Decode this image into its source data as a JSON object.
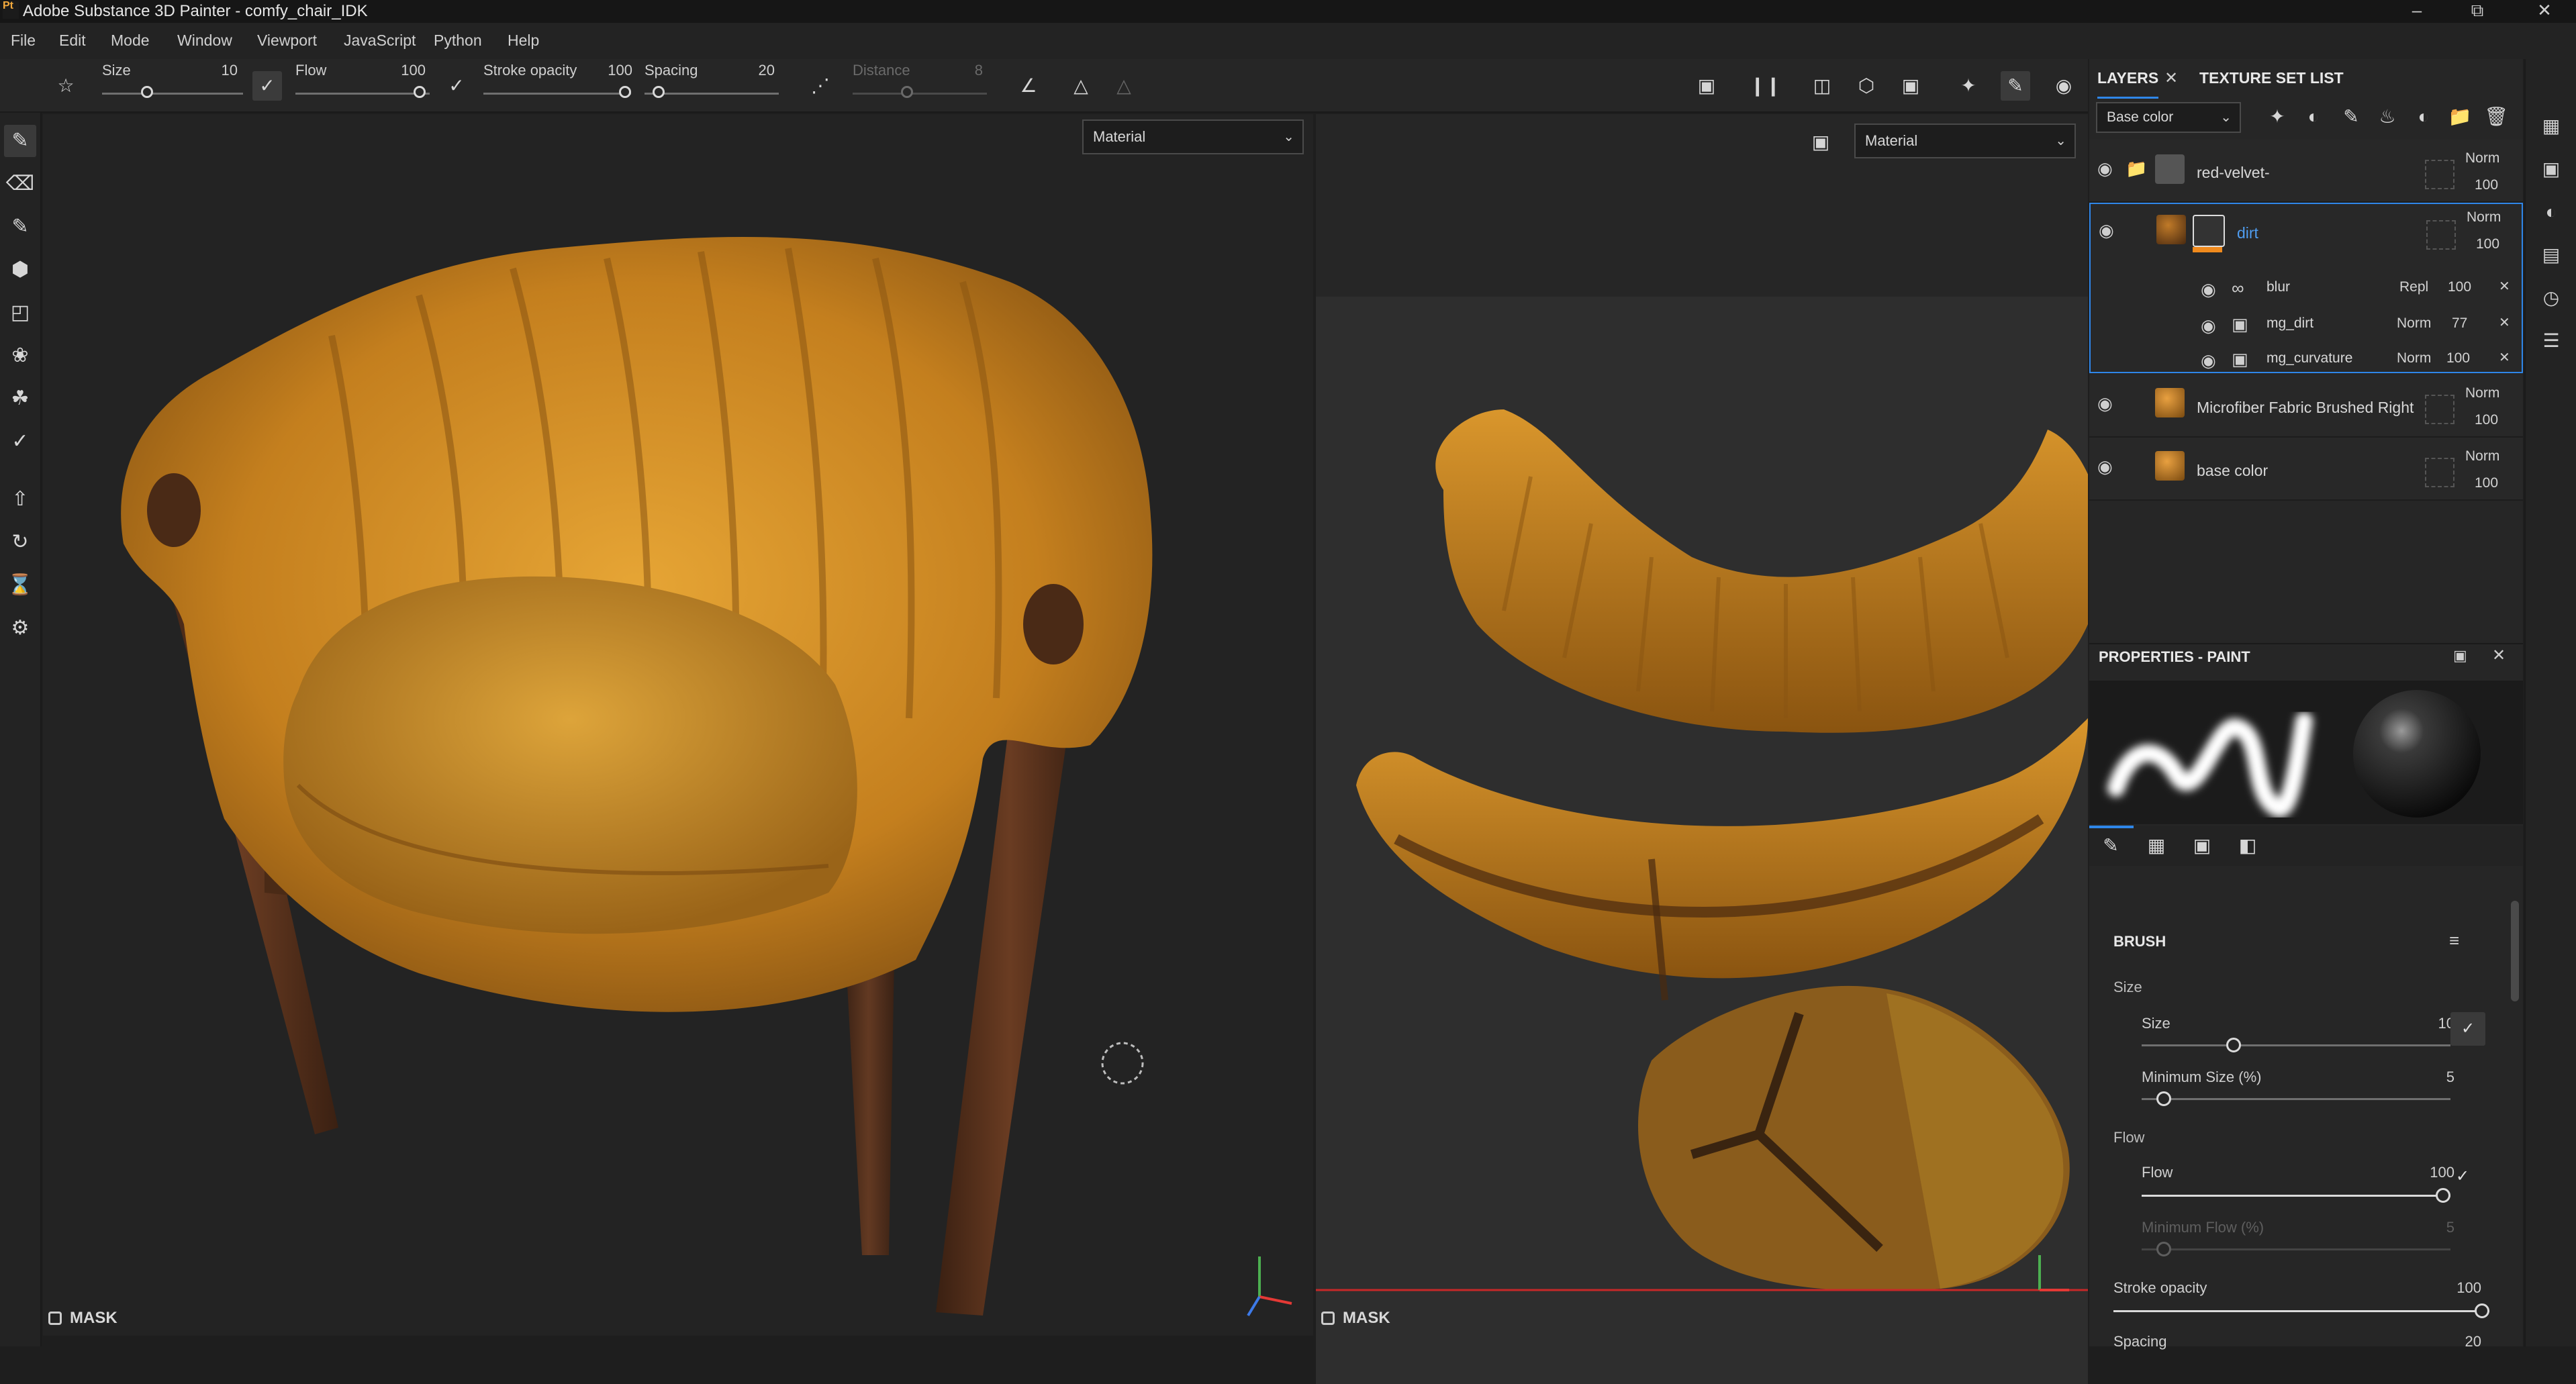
{
  "app": {
    "title": "Adobe Substance 3D Painter - comfy_chair_IDK",
    "logo_text": "Pt",
    "window_controls": [
      "minimize-icon",
      "restore-icon",
      "close-icon"
    ]
  },
  "menu": [
    "File",
    "Edit",
    "Mode",
    "Window",
    "Viewport",
    "JavaScript",
    "Python",
    "Help"
  ],
  "toolbar": {
    "size_label": "Size",
    "size_value": "10",
    "flow_label": "Flow",
    "flow_value": "100",
    "stroke_label": "Stroke opacity",
    "stroke_value": "100",
    "spacing_label": "Spacing",
    "spacing_value": "20",
    "distance_label": "Distance",
    "distance_value": "8"
  },
  "viewport3d": {
    "mode_select": "Material",
    "mask_label": "MASK"
  },
  "viewport2d": {
    "mode_select": "Material",
    "mask_label": "MASK"
  },
  "layers": {
    "tab_layers": "LAYERS",
    "tab_texture_set": "TEXTURE SET LIST",
    "channel_select": "Base color",
    "rows": [
      {
        "name": "red-velvet-",
        "blend": "Norm",
        "opacity": "100"
      },
      {
        "name": "dirt",
        "blend": "Norm",
        "opacity": "100"
      },
      {
        "name": "Microfiber Fabric Brushed Right",
        "blend": "Norm",
        "opacity": "100"
      },
      {
        "name": "base color",
        "blend": "Norm",
        "opacity": "100"
      }
    ],
    "effects": [
      {
        "name": "blur",
        "blend": "Repl",
        "opacity": "100"
      },
      {
        "name": "mg_dirt",
        "blend": "Norm",
        "opacity": "77"
      },
      {
        "name": "mg_curvature",
        "blend": "Norm",
        "opacity": "100"
      }
    ]
  },
  "properties": {
    "title": "PROPERTIES - PAINT",
    "section_brush": "BRUSH",
    "size_group": "Size",
    "size_label": "Size",
    "size_value": "10",
    "min_size_label": "Minimum Size (%)",
    "min_size_value": "5",
    "flow_group": "Flow",
    "flow_label": "Flow",
    "flow_value": "100",
    "min_flow_label": "Minimum Flow (%)",
    "min_flow_value": "5",
    "stroke_label": "Stroke opacity",
    "stroke_value": "100",
    "spacing_label": "Spacing",
    "spacing_value": "20"
  },
  "colors": {
    "accent": "#2f86e8",
    "fabric": "#d9952a",
    "wood": "#5a3320",
    "active_layer_bar": "#f08a1d"
  }
}
